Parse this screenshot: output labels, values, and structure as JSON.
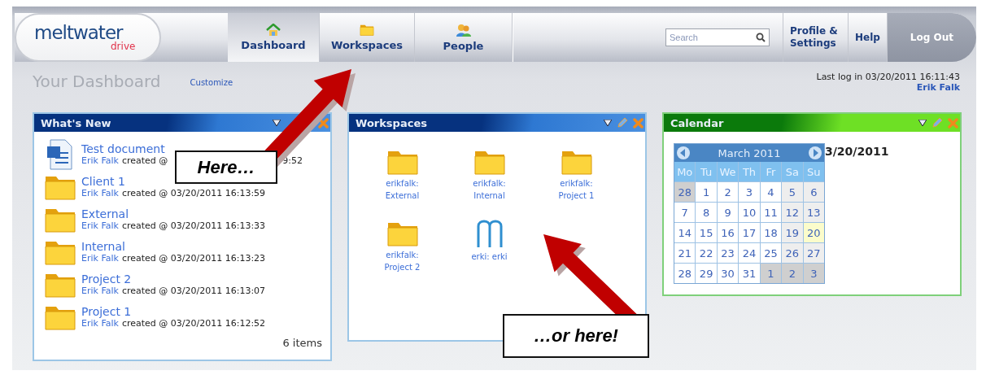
{
  "logo": {
    "name": "meltwater",
    "sub": "drive"
  },
  "tabs": [
    {
      "label": "Dashboard",
      "selected": true
    },
    {
      "label": "Workspaces",
      "selected": false
    },
    {
      "label": "People",
      "selected": false
    }
  ],
  "search": {
    "placeholder": "Search"
  },
  "nav_links": [
    {
      "label": "Profile & Settings",
      "kind": "link"
    },
    {
      "label": "Help",
      "kind": "link"
    },
    {
      "label": "Log Out",
      "kind": "logout"
    }
  ],
  "page": {
    "title": "Your Dashboard",
    "customize": "Customize",
    "last_login": "Last log in 03/20/2011 16:11:43",
    "user": "Erik Falk"
  },
  "whats_new": {
    "title": "What's New",
    "count": "6 items",
    "items": [
      {
        "kind": "document",
        "name": "Test document",
        "author": "Erik Falk",
        "meta": "created @",
        "meta_tail": "9:52"
      },
      {
        "kind": "folder",
        "name": "Client 1",
        "author": "Erik Falk",
        "meta": "created @ 03/20/2011 16:13:59"
      },
      {
        "kind": "folder",
        "name": "External",
        "author": "Erik Falk",
        "meta": "created @ 03/20/2011 16:13:33"
      },
      {
        "kind": "folder",
        "name": "Internal",
        "author": "Erik Falk",
        "meta": "created @ 03/20/2011 16:13:23"
      },
      {
        "kind": "folder",
        "name": "Project 2",
        "author": "Erik Falk",
        "meta": "created @ 03/20/2011 16:13:07"
      },
      {
        "kind": "folder",
        "name": "Project 1",
        "author": "Erik Falk",
        "meta": "created @ 03/20/2011 16:12:52"
      }
    ]
  },
  "workspaces": {
    "title": "Workspaces",
    "items": [
      {
        "kind": "folder",
        "label": "erikfalk:\nExternal"
      },
      {
        "kind": "folder",
        "label": "erikfalk:\nInternal"
      },
      {
        "kind": "folder",
        "label": "erikfalk:\nProject 1"
      },
      {
        "kind": "folder",
        "label": "erikfalk:\nProject 2"
      },
      {
        "kind": "logo",
        "label": "erki: erki"
      }
    ]
  },
  "calendar": {
    "title": "Calendar",
    "month": "March 2011",
    "selected_date": "3/20/2011",
    "weekdays": [
      "Mo",
      "Tu",
      "We",
      "Th",
      "Fr",
      "Sa",
      "Su"
    ],
    "weeks": [
      [
        {
          "day": "28",
          "kind": "outside"
        },
        {
          "day": "1",
          "kind": "normal"
        },
        {
          "day": "2",
          "kind": "normal"
        },
        {
          "day": "3",
          "kind": "normal"
        },
        {
          "day": "4",
          "kind": "normal"
        },
        {
          "day": "5",
          "kind": "weekend"
        },
        {
          "day": "6",
          "kind": "weekend"
        }
      ],
      [
        {
          "day": "7",
          "kind": "normal"
        },
        {
          "day": "8",
          "kind": "normal"
        },
        {
          "day": "9",
          "kind": "normal"
        },
        {
          "day": "10",
          "kind": "normal"
        },
        {
          "day": "11",
          "kind": "normal"
        },
        {
          "day": "12",
          "kind": "weekend"
        },
        {
          "day": "13",
          "kind": "weekend"
        }
      ],
      [
        {
          "day": "14",
          "kind": "normal"
        },
        {
          "day": "15",
          "kind": "normal"
        },
        {
          "day": "16",
          "kind": "normal"
        },
        {
          "day": "17",
          "kind": "normal"
        },
        {
          "day": "18",
          "kind": "normal"
        },
        {
          "day": "19",
          "kind": "weekend"
        },
        {
          "day": "20",
          "kind": "today"
        }
      ],
      [
        {
          "day": "21",
          "kind": "normal"
        },
        {
          "day": "22",
          "kind": "normal"
        },
        {
          "day": "23",
          "kind": "normal"
        },
        {
          "day": "24",
          "kind": "normal"
        },
        {
          "day": "25",
          "kind": "normal"
        },
        {
          "day": "26",
          "kind": "weekend"
        },
        {
          "day": "27",
          "kind": "weekend"
        }
      ],
      [
        {
          "day": "28",
          "kind": "normal"
        },
        {
          "day": "29",
          "kind": "normal"
        },
        {
          "day": "30",
          "kind": "normal"
        },
        {
          "day": "31",
          "kind": "normal"
        },
        {
          "day": "1",
          "kind": "outside"
        },
        {
          "day": "2",
          "kind": "outside"
        },
        {
          "day": "3",
          "kind": "outside"
        }
      ]
    ]
  },
  "callouts": [
    {
      "text": "Here…"
    },
    {
      "text": "…or here!"
    }
  ]
}
